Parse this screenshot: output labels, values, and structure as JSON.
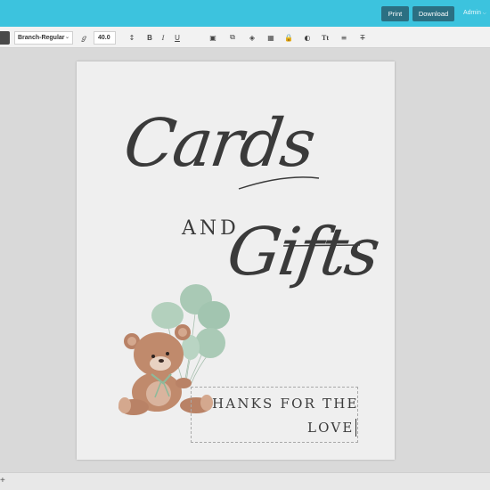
{
  "header": {
    "print_label": "Print",
    "download_label": "Download",
    "user_label": "Admin"
  },
  "toolbar": {
    "font_name": "Branch-Regular",
    "font_size": "40.0",
    "bold": "B",
    "italic": "I",
    "underline": "U",
    "text_type": "Tt"
  },
  "design": {
    "title_line1": "Cards",
    "title_and": "AND",
    "title_line2": "Gifts",
    "thanks_line1": "HANKS FOR THE",
    "thanks_line2": "LOVE"
  },
  "bottom": {
    "add_symbol": "+"
  },
  "colors": {
    "topbar": "#3cc3de",
    "button": "#2b6f82",
    "balloon": "#a9c9b5",
    "bear": "#b98266"
  }
}
